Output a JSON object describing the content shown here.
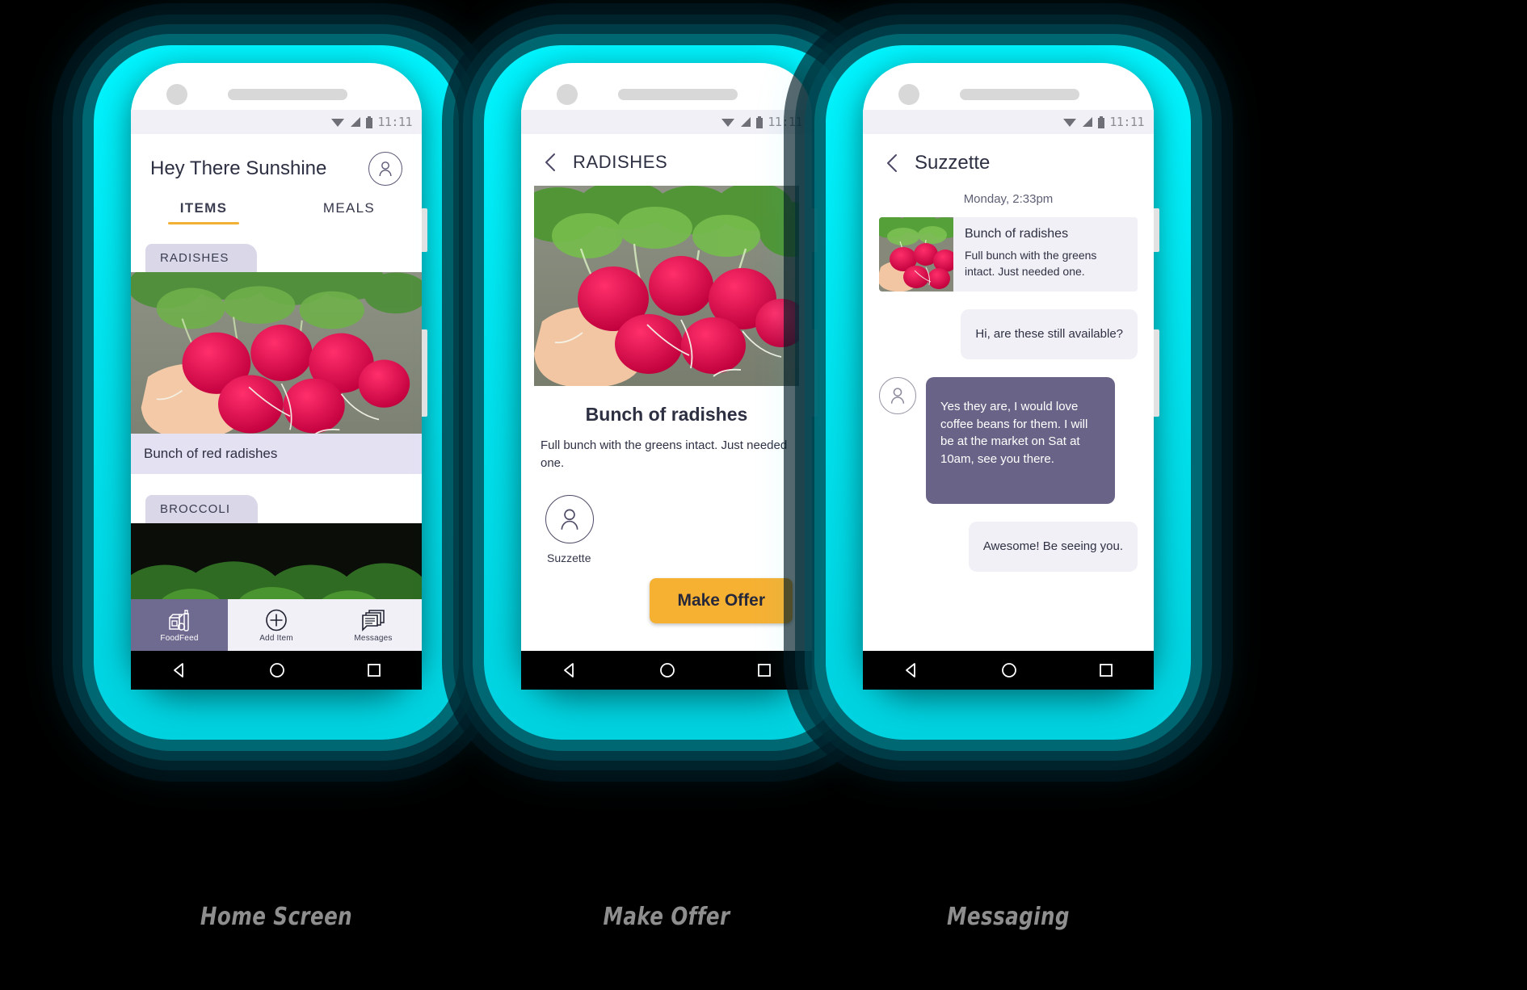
{
  "captions": [
    {
      "label": "Home Screen"
    },
    {
      "label": "Make Offer"
    },
    {
      "label": "Messaging"
    }
  ],
  "colors": {
    "glow_cyan": "#00f5ff",
    "accent_amber": "#f6b133",
    "chip_lavender": "#d9d7e8",
    "bubble_purple": "#696487",
    "bubble_grey": "#f1f0f6",
    "text_dark": "#2d2f42"
  },
  "status_bar": {
    "time": "11:11",
    "icons": [
      "wifi-icon",
      "signal-icon",
      "battery-icon"
    ]
  },
  "screens": {
    "home": {
      "title": "Hey There Sunshine",
      "avatar_icon": "person-avatar-icon",
      "tabs": [
        {
          "label": "ITEMS",
          "active": true
        },
        {
          "label": "MEALS",
          "active": false
        }
      ],
      "listings": [
        {
          "chip": "RADISHES",
          "caption": "Bunch of red radishes"
        },
        {
          "chip": "BROCCOLI",
          "caption": ""
        }
      ],
      "bottom_nav": [
        {
          "label": "FoodFeed",
          "icon": "groceries-icon",
          "active": true
        },
        {
          "label": "Add Item",
          "icon": "plus-circle-icon",
          "active": false
        },
        {
          "label": "Messages",
          "icon": "messages-icon",
          "active": false
        }
      ]
    },
    "detail": {
      "back_icon": "chevron-left-icon",
      "title": "RADISHES",
      "item_title": "Bunch of radishes",
      "item_desc": "Full bunch with the greens intact. Just needed one.",
      "seller": {
        "name": "Suzzette",
        "avatar_icon": "person-avatar-icon"
      },
      "cta": "Make Offer"
    },
    "messaging": {
      "back_icon": "chevron-left-icon",
      "title": "Suzzette",
      "timestamp": "Monday, 2:33pm",
      "messages": [
        {
          "type": "card",
          "side": "left",
          "title": "Bunch of radishes",
          "text": "Full bunch with the greens intact. Just needed one."
        },
        {
          "type": "bubble",
          "side": "right",
          "style": "grey",
          "text": "Hi, are these still available?"
        },
        {
          "type": "bubble",
          "side": "left",
          "style": "purple",
          "avatar_icon": "person-avatar-icon",
          "text": "Yes they are, I would love coffee beans for them. I will be at the market on Sat at 10am, see you there."
        },
        {
          "type": "bubble",
          "side": "right",
          "style": "grey",
          "text": "Awesome! Be seeing you."
        }
      ]
    }
  },
  "android_nav": {
    "back": "triangle-back-icon",
    "home": "circle-home-icon",
    "recents": "square-recents-icon"
  }
}
